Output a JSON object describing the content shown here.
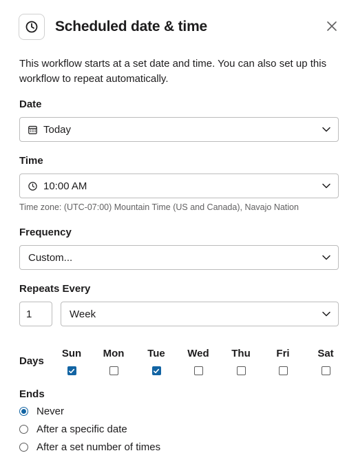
{
  "dialog": {
    "title": "Scheduled date & time",
    "description": "This workflow starts at a set date and time. You can also set up this workflow to repeat automatically."
  },
  "date": {
    "label": "Date",
    "value": "Today"
  },
  "time": {
    "label": "Time",
    "value": "10:00 AM",
    "timezone_hint": "Time zone: (UTC-07:00) Mountain Time (US and Canada), Navajo Nation"
  },
  "frequency": {
    "label": "Frequency",
    "value": "Custom..."
  },
  "repeats": {
    "label": "Repeats Every",
    "count": "1",
    "unit": "Week"
  },
  "days": {
    "label": "Days",
    "items": [
      {
        "name": "Sun",
        "checked": true
      },
      {
        "name": "Mon",
        "checked": false
      },
      {
        "name": "Tue",
        "checked": true
      },
      {
        "name": "Wed",
        "checked": false
      },
      {
        "name": "Thu",
        "checked": false
      },
      {
        "name": "Fri",
        "checked": false
      },
      {
        "name": "Sat",
        "checked": false
      }
    ]
  },
  "ends": {
    "label": "Ends",
    "options": [
      {
        "label": "Never",
        "selected": true
      },
      {
        "label": "After a specific date",
        "selected": false
      },
      {
        "label": "After a set number of times",
        "selected": false
      }
    ]
  },
  "colors": {
    "accent": "#1264a3",
    "text": "#1d1c1d",
    "hint": "#616061",
    "border": "#bcbcbc"
  },
  "icons": {
    "header": "clock-icon",
    "close": "close-icon",
    "date": "calendar-icon",
    "time": "clock-icon",
    "dropdown": "chevron-down-icon"
  }
}
